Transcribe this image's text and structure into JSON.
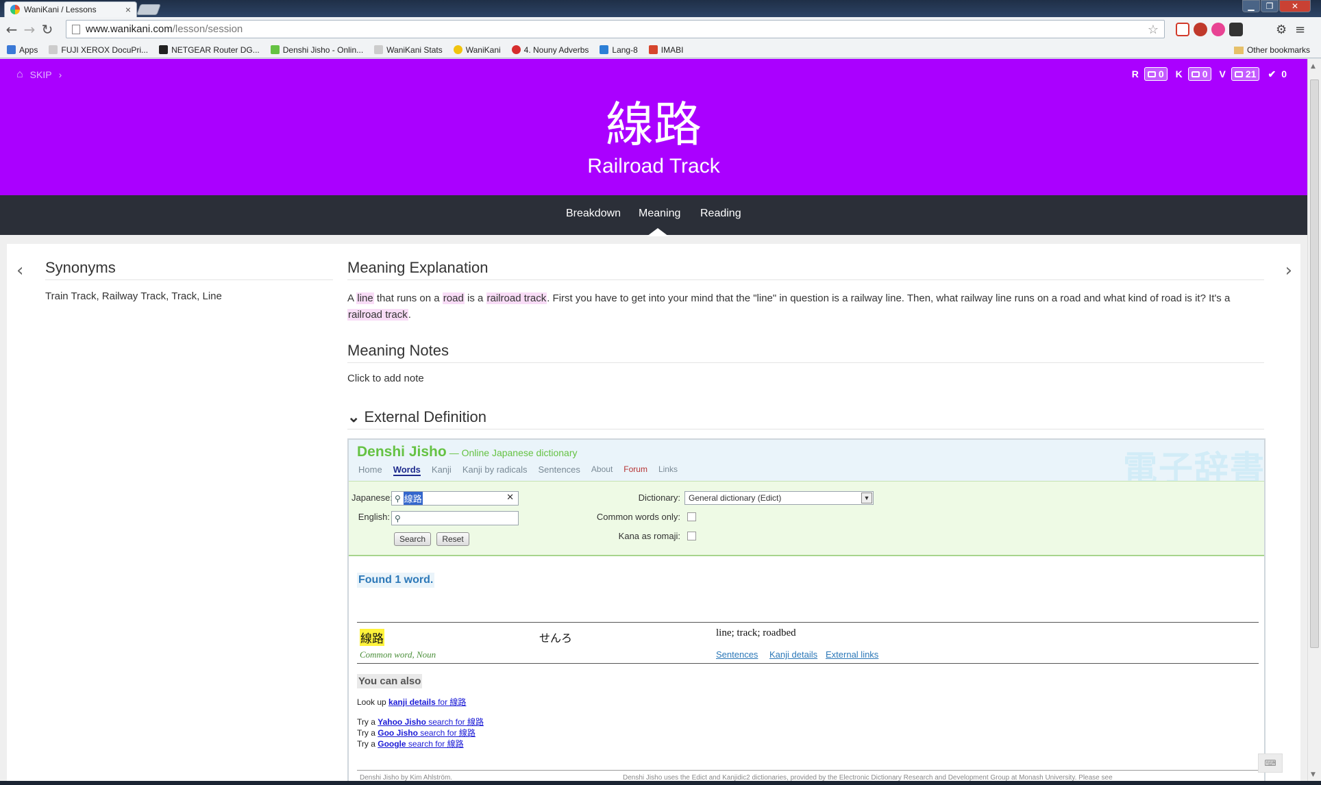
{
  "browser": {
    "tab_title": "WaniKani / Lessons",
    "url_host": "www.wanikani.com",
    "url_path": "/lesson/session",
    "window": {
      "minimize": "▁",
      "maximize": "❐",
      "close": "✕"
    }
  },
  "bookmarks": [
    {
      "label": "Apps",
      "icon_color": "#3b79d6"
    },
    {
      "label": "FUJI XEROX DocuPri...",
      "icon_color": "#888888"
    },
    {
      "label": "NETGEAR Router DG...",
      "icon_color": "#222222"
    },
    {
      "label": "Denshi Jisho - Onlin...",
      "icon_color": "#65c243"
    },
    {
      "label": "WaniKani Stats",
      "icon_color": "#888888"
    },
    {
      "label": "WaniKani",
      "icon_color": "#f1c40f"
    },
    {
      "label": "4. Nouny Adverbs",
      "icon_color": "#d62d2d"
    },
    {
      "label": "Lang-8",
      "icon_color": "#2d7fd6"
    },
    {
      "label": "IMABI",
      "icon_color": "#d6452d"
    }
  ],
  "other_bookmarks": "Other bookmarks",
  "header": {
    "skip": "SKIP",
    "counts": [
      {
        "letter": "R",
        "value": "0"
      },
      {
        "letter": "K",
        "value": "0"
      },
      {
        "letter": "V",
        "value": "21"
      }
    ],
    "done": "0",
    "character": "線路",
    "meaning": "Railroad Track"
  },
  "lesson_tabs": [
    "Breakdown",
    "Meaning",
    "Reading"
  ],
  "synonyms": {
    "title": "Synonyms",
    "text": "Train Track, Railway Track, Track, Line"
  },
  "explanation": {
    "title": "Meaning Explanation",
    "p1": "A ",
    "h1": "line",
    "p2": " that runs on a ",
    "h2": "road",
    "p3": " is a ",
    "h3": "railroad track",
    "p4": ". First you have to get into your mind that the \"line\" in question is a railway line. Then, what railway line runs on a road and what kind of road is it? It's a ",
    "h4": "railroad track",
    "p5": "."
  },
  "notes": {
    "title": "Meaning Notes",
    "placeholder": "Click to add note"
  },
  "external": {
    "title": "External Definition"
  },
  "jisho": {
    "title": "Denshi Jisho",
    "subtitle": "— Online Japanese dictionary",
    "watermark": "電子辞書",
    "nav": [
      "Home",
      "Words",
      "Kanji",
      "Kanji by radicals",
      "Sentences",
      "About",
      "Forum",
      "Links"
    ],
    "japanese_label": "Japanese:",
    "japanese_value": "線路",
    "english_label": "English:",
    "search_btn": "Search",
    "reset_btn": "Reset",
    "dictionary_label": "Dictionary:",
    "dictionary_value": "General dictionary (Edict)",
    "common_label": "Common words only:",
    "kana_label": "Kana as romaji:",
    "found": "Found 1 word.",
    "result": {
      "word": "線路",
      "reading": "せんろ",
      "meaning": "line; track; roadbed",
      "tag": "Common word, Noun",
      "links": [
        "Sentences",
        "Kanji details",
        "External links"
      ]
    },
    "also_title": "You can also",
    "also": [
      {
        "pre": "Look up ",
        "bold": "kanji details",
        "post": " for 線路"
      },
      {
        "pre": "Try a ",
        "bold": "Yahoo Jisho",
        "post": " search for 線路"
      },
      {
        "pre": "Try a ",
        "bold": "Goo Jisho",
        "post": " search for 線路"
      },
      {
        "pre": "Try a ",
        "bold": "Google",
        "post": " search for 線路"
      }
    ],
    "footer_left": "Denshi Jisho by Kim Ahlström.",
    "footer_right": "Denshi Jisho uses the Edict and Kanjidic2 dictionaries, provided by the Electronic Dictionary Research and Development Group at Monash University. Please see"
  },
  "colors": {
    "vocab_purple": "#aa00ff",
    "tab_bar": "#2b2f38",
    "highlight_pink": "#f8dcf6",
    "jisho_green": "#65c243"
  }
}
